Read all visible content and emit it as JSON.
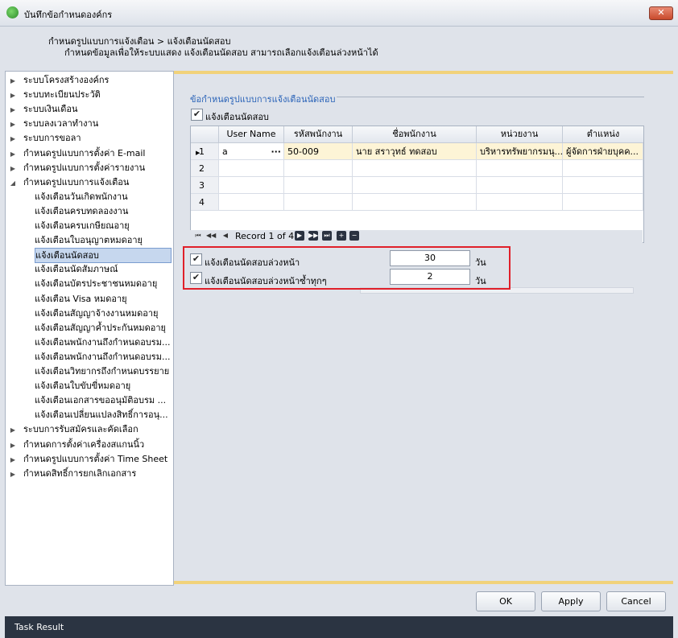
{
  "window": {
    "title": "บันทึกข้อกำหนดองค์กร",
    "close_label": "✕"
  },
  "header": {
    "breadcrumb": "กำหนดรูปแบบการแจ้งเตือน > แจ้งเตือนนัดสอบ",
    "description": "กำหนดข้อมูลเพื่อให้ระบบแสดง แจ้งเตือนนัดสอบ สามารถเลือกแจ้งเตือนล่วงหน้าได้"
  },
  "tree": {
    "items": [
      {
        "label": "ระบบโครงสร้างองค์กร",
        "toggle": "▶"
      },
      {
        "label": "ระบบทะเบียนประวัติ",
        "toggle": "▶"
      },
      {
        "label": "ระบบเงินเดือน",
        "toggle": "▶"
      },
      {
        "label": "ระบบลงเวลาทำงาน",
        "toggle": "▶"
      },
      {
        "label": "ระบบการขอลา",
        "toggle": "▶"
      },
      {
        "label": "กำหนดรูปแบบการตั้งค่า E-mail",
        "toggle": "▶"
      },
      {
        "label": "กำหนดรูปแบบการตั้งค่ารายงาน",
        "toggle": "▶"
      },
      {
        "label": "กำหนดรูปแบบการแจ้งเตือน",
        "toggle": "◢"
      },
      {
        "label": "แจ้งเตือนวันเกิดพนักงาน"
      },
      {
        "label": "แจ้งเตือนครบทดลองงาน"
      },
      {
        "label": "แจ้งเตือนครบเกษียณอายุ"
      },
      {
        "label": "แจ้งเตือนใบอนุญาตหมดอายุ"
      },
      {
        "label": "แจ้งเตือนนัดสอบ"
      },
      {
        "label": "แจ้งเตือนนัดสัมภาษณ์"
      },
      {
        "label": "แจ้งเตือนบัตรประชาชนหมดอายุ"
      },
      {
        "label": "แจ้งเตือน Visa หมดอายุ"
      },
      {
        "label": "แจ้งเตือนสัญญาจ้างงานหมดอายุ"
      },
      {
        "label": "แจ้งเตือนสัญญาค้ำประกันหมดอายุ"
      },
      {
        "label": "แจ้งเตือนพนักงานถึงกำหนดอบรม..."
      },
      {
        "label": "แจ้งเตือนพนักงานถึงกำหนดอบรม..."
      },
      {
        "label": "แจ้งเตือนวิทยากรถึงกำหนดบรรยาย"
      },
      {
        "label": "แจ้งเตือนใบขับขี่หมดอายุ"
      },
      {
        "label": "แจ้งเตือนเอกสารขออนุมัติอบรม ..."
      },
      {
        "label": "แจ้งเตือนเปลี่ยนแปลงสิทธิ์การอนุ..."
      },
      {
        "label": "ระบบการรับสมัครและคัดเลือก",
        "toggle": "▶"
      },
      {
        "label": "กำหนดการตั้งค่าเครื่องสแกนนิ้ว",
        "toggle": "▶"
      },
      {
        "label": "กำหนดรูปแบบการตั้งค่า Time Sheet",
        "toggle": "▶"
      },
      {
        "label": "กำหนดสิทธิ์การยกเลิกเอกสาร",
        "toggle": "▶"
      }
    ]
  },
  "form": {
    "group_title": "ข้อกำหนดรูปแบบการแจ้งเตือนนัดสอบ",
    "enable_label": "แจ้งเตือนนัดสอบ",
    "check_mark": "✔",
    "grid": {
      "columns": [
        "",
        "User Name",
        "รหัสพนักงาน",
        "ชื่อพนักงาน",
        "หน่วยงาน",
        "ตำแหน่ง"
      ],
      "rows": [
        {
          "num": "1",
          "indicator": "▶",
          "user": "a",
          "ellipsis": "···",
          "code": "50-009",
          "name": "นาย สราวุทธ์ ทดสอบ",
          "dept": "บริหารทรัพยากรมนุ...",
          "pos": "ผู้จัดการฝ่ายบุคค..."
        },
        {
          "num": "2",
          "indicator": "",
          "user": "",
          "ellipsis": "",
          "code": "",
          "name": "",
          "dept": "",
          "pos": ""
        },
        {
          "num": "3",
          "indicator": "",
          "user": "",
          "ellipsis": "",
          "code": "",
          "name": "",
          "dept": "",
          "pos": ""
        },
        {
          "num": "4",
          "indicator": "",
          "user": "",
          "ellipsis": "",
          "code": "",
          "name": "",
          "dept": "",
          "pos": ""
        }
      ]
    },
    "nav": {
      "first": "⏮",
      "prev_page": "◀◀",
      "prev": "◀",
      "record_label": "Record 1 of 4",
      "next": "▶",
      "next_page": "▶▶",
      "last": "⏭",
      "add": "+",
      "remove": "−"
    },
    "advance": {
      "label": "แจ้งเตือนนัดสอบล่วงหน้า",
      "value": "30",
      "unit": "วัน"
    },
    "repeat": {
      "label": "แจ้งเตือนนัดสอบล่วงหน้าซ้ำทุกๆ",
      "value": "2",
      "unit": "วัน"
    }
  },
  "buttons": {
    "ok": "OK",
    "apply": "Apply",
    "cancel": "Cancel"
  },
  "status": {
    "text": "Task Result"
  }
}
